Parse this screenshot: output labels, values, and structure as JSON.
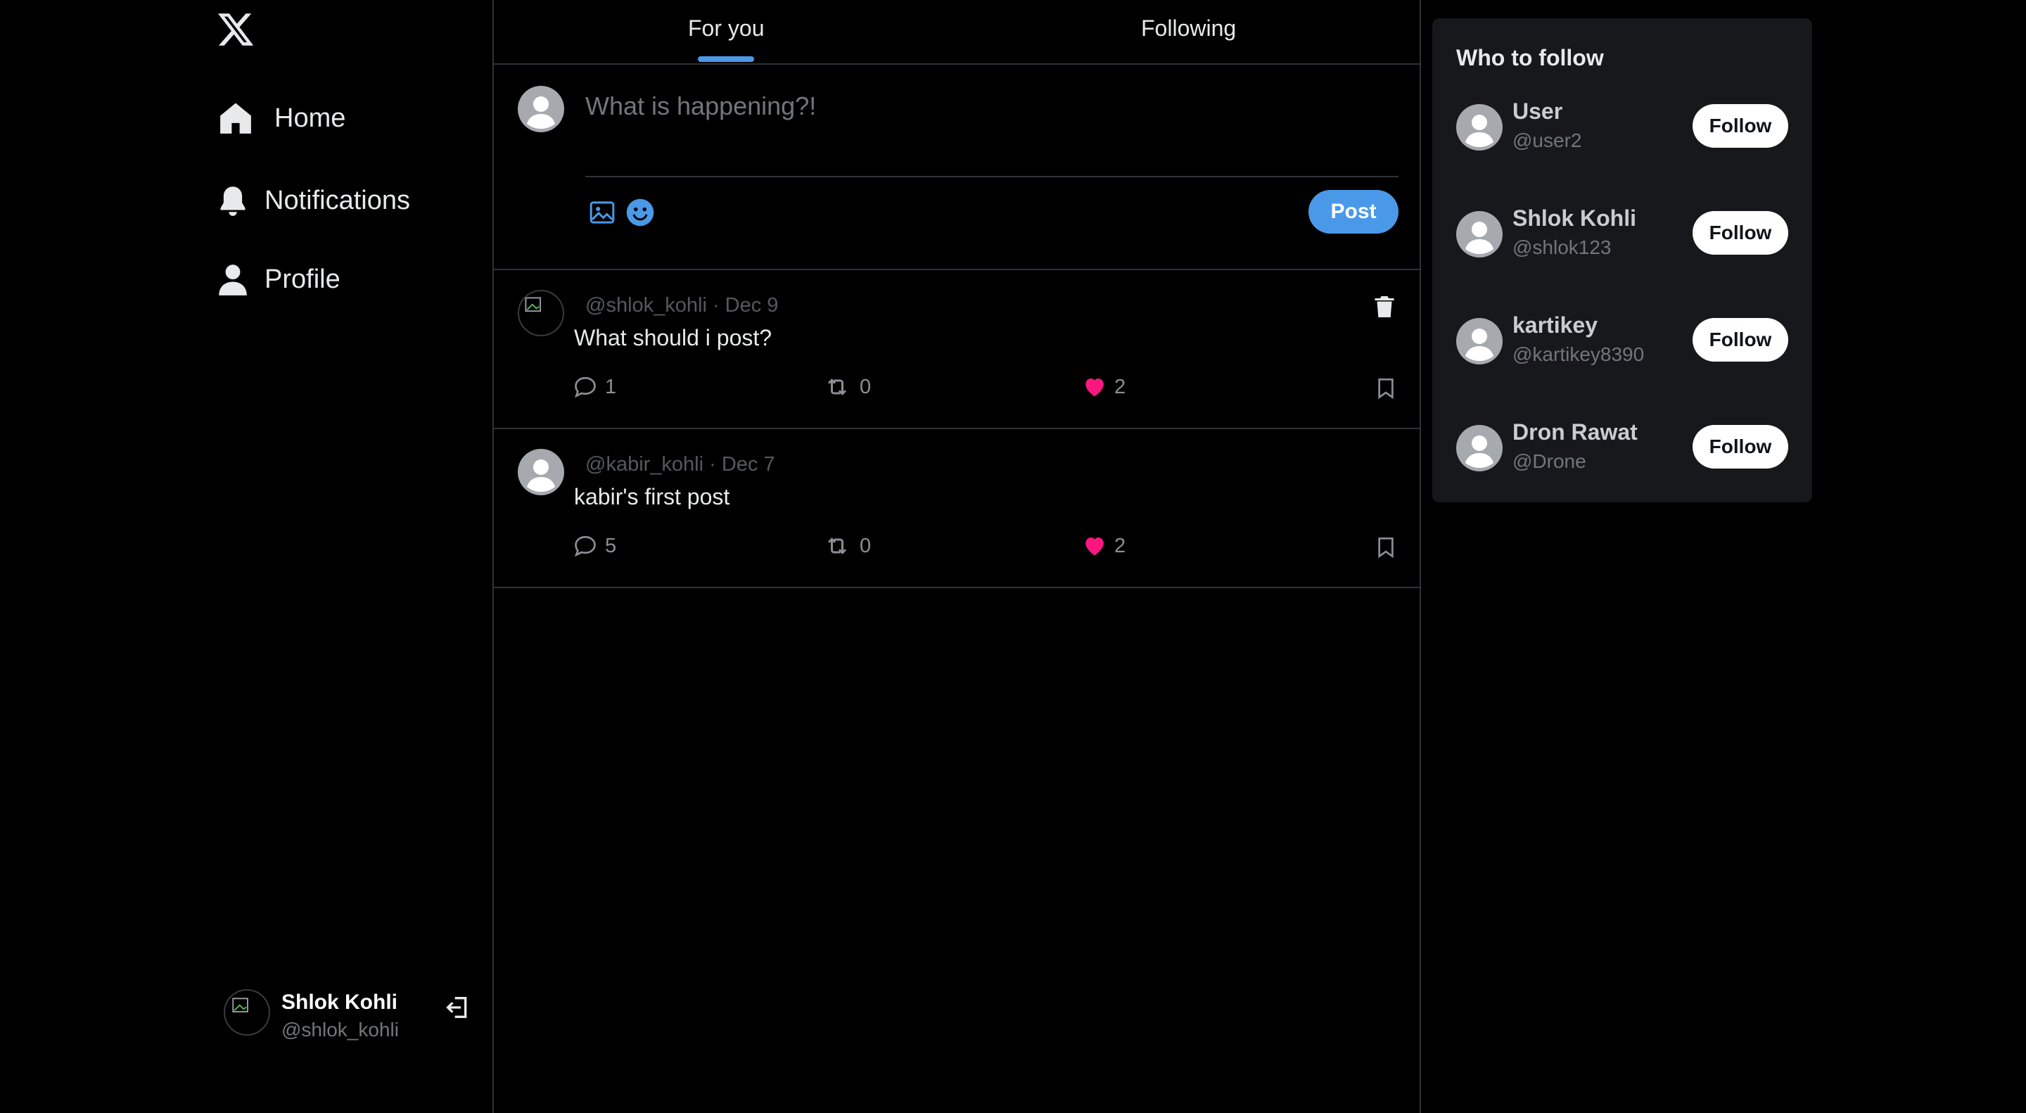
{
  "sidebar": {
    "logo": "X",
    "nav": [
      {
        "label": "Home",
        "icon": "home-icon"
      },
      {
        "label": "Notifications",
        "icon": "bell-icon"
      },
      {
        "label": "Profile",
        "icon": "person-icon"
      }
    ],
    "account": {
      "name": "Shlok Kohli",
      "handle": "@shlok_kohli",
      "logout_icon": "logout-icon"
    }
  },
  "tabs": [
    {
      "label": "For you",
      "active": true
    },
    {
      "label": "Following",
      "active": false
    }
  ],
  "composer": {
    "placeholder": "What is happening?!",
    "post_label": "Post",
    "icons": [
      "image-icon",
      "emoji-icon"
    ]
  },
  "posts": [
    {
      "handle": "@shlok_kohli",
      "date": "Dec 9",
      "meta": "@shlok_kohli · Dec 9",
      "text": "What should i post?",
      "replies": "1",
      "reposts": "0",
      "likes": "2",
      "deletable": true
    },
    {
      "handle": "@kabir_kohli",
      "date": "Dec 7",
      "meta": "@kabir_kohli · Dec 7",
      "text": "kabir's first post",
      "replies": "5",
      "reposts": "0",
      "likes": "2",
      "deletable": false
    }
  ],
  "who_to_follow": {
    "title": "Who to follow",
    "follow_label": "Follow",
    "users": [
      {
        "name": "User",
        "handle": "@user2"
      },
      {
        "name": "Shlok Kohli",
        "handle": "@shlok123"
      },
      {
        "name": "kartikey",
        "handle": "@kartikey8390"
      },
      {
        "name": "Dron Rawat",
        "handle": "@Drone"
      }
    ]
  },
  "colors": {
    "background": "#000000",
    "accent": "#4a99e9",
    "like": "#f91880",
    "muted_text": "#71767b",
    "border": "#2f3336",
    "panel": "#16181c"
  }
}
